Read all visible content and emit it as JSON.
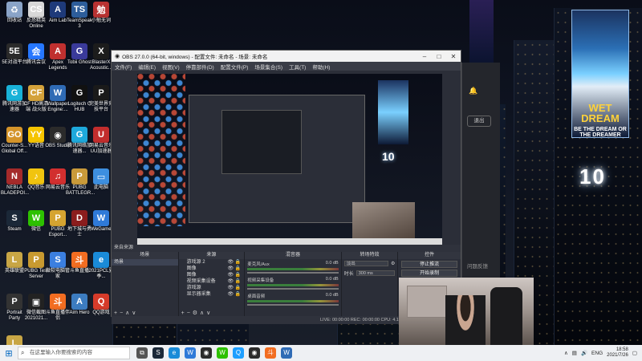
{
  "desktop_icons": [
    {
      "label": "回收站",
      "icon": "recycle-bin-icon",
      "color": "#8aa4c8",
      "glyph": "♻"
    },
    {
      "label": "反恐精英 Online",
      "icon": "cs-online-icon",
      "color": "#d8d8d8",
      "glyph": "CS"
    },
    {
      "label": "Aim Lab",
      "icon": "aimlab-icon",
      "color": "#1e3a7a",
      "glyph": "A"
    },
    {
      "label": "TeamSpeak 3",
      "icon": "teamspeak-icon",
      "color": "#2d5d9a",
      "glyph": "TS"
    },
    {
      "label": "小勉无词",
      "icon": "app-icon",
      "color": "#b83232",
      "glyph": "勉"
    },
    {
      "label": "5E对战平台",
      "icon": "5e-icon",
      "color": "#2a2a2a",
      "glyph": "5E"
    },
    {
      "label": "腾讯会议",
      "icon": "tencent-meeting-icon",
      "color": "#2677ff",
      "glyph": "会"
    },
    {
      "label": "Apex Legends",
      "icon": "apex-icon",
      "color": "#c0302f",
      "glyph": "A"
    },
    {
      "label": "Tobii Ghost",
      "icon": "tobii-icon",
      "color": "#3a3a9a",
      "glyph": "G"
    },
    {
      "label": "BlasterX Acoustic...",
      "icon": "blasterx-icon",
      "color": "#1c1c1c",
      "glyph": "X"
    },
    {
      "label": "腾讯网游加速器",
      "icon": "accelerator-icon",
      "color": "#19b2d8",
      "glyph": "G"
    },
    {
      "label": "CF HD高清端 战火版",
      "icon": "cf-icon",
      "color": "#d4a23a",
      "glyph": "CF"
    },
    {
      "label": "Wallpaper Engine:...",
      "icon": "wallpaper-engine-icon",
      "color": "#2f6bb5",
      "glyph": "W"
    },
    {
      "label": "Logitech G HUB",
      "icon": "logitech-icon",
      "color": "#111111",
      "glyph": "G"
    },
    {
      "label": "完美世界竞技平台",
      "icon": "perfect-world-icon",
      "color": "#1a1a1a",
      "glyph": "P"
    },
    {
      "label": "Counter-S... Global Off...",
      "icon": "csgo-icon",
      "color": "#d4942a",
      "glyph": "GO"
    },
    {
      "label": "YY语音",
      "icon": "yy-icon",
      "color": "#f5c400",
      "glyph": "YY"
    },
    {
      "label": "OBS Studio",
      "icon": "obs-icon",
      "color": "#2b2b2b",
      "glyph": "◉"
    },
    {
      "label": "腾讯网络加速器...",
      "icon": "accelerator-icon",
      "color": "#1ea9dc",
      "glyph": "G"
    },
    {
      "label": "网易云音乐 UU加速器",
      "icon": "uu-icon",
      "color": "#c22d2d",
      "glyph": "U"
    },
    {
      "label": "NEBLA BLADEPOI...",
      "icon": "game-icon",
      "color": "#a52a2a",
      "glyph": "N"
    },
    {
      "label": "QQ音乐",
      "icon": "qq-music-icon",
      "color": "#f1c40f",
      "glyph": "♪"
    },
    {
      "label": "网易云音乐",
      "icon": "netease-music-icon",
      "color": "#d22f2f",
      "glyph": "♫"
    },
    {
      "label": "PUBG BATTLEGR...",
      "icon": "pubg-icon",
      "color": "#c99a3a",
      "glyph": "P"
    },
    {
      "label": "此电脑",
      "icon": "this-pc-icon",
      "color": "#3d8fe0",
      "glyph": "▭"
    },
    {
      "label": "Steam",
      "icon": "steam-icon",
      "color": "#1b2838",
      "glyph": "S"
    },
    {
      "label": "微信",
      "icon": "wechat-icon",
      "color": "#2dc100",
      "glyph": "W"
    },
    {
      "label": "PUBG Esport...",
      "icon": "pubg-esport-icon",
      "color": "#d5a431",
      "glyph": "P"
    },
    {
      "label": "地下城与勇士",
      "icon": "dnf-icon",
      "color": "#8b1d1d",
      "glyph": "D"
    },
    {
      "label": "WeGame",
      "icon": "wegame-icon",
      "color": "#2f7ad8",
      "glyph": "W"
    },
    {
      "label": "英雄联盟",
      "icon": "lol-icon",
      "color": "#c8a645",
      "glyph": "L"
    },
    {
      "label": "PUBG Test Server",
      "icon": "pubg-test-icon",
      "color": "#c89a30",
      "glyph": "P"
    },
    {
      "label": "微软电脑管家",
      "icon": "pc-manager-icon",
      "color": "#3b7fe0",
      "glyph": "S"
    },
    {
      "label": "斗鱼直播",
      "icon": "douyu-icon",
      "color": "#f26d21",
      "glyph": "斗"
    },
    {
      "label": "2021PCL夏季...",
      "icon": "edge-icon",
      "color": "#1a8bd8",
      "glyph": "e"
    },
    {
      "label": "Portrait Party",
      "icon": "game-icon",
      "color": "#333333",
      "glyph": "P"
    },
    {
      "label": "微信截图 2021021...",
      "icon": "image-icon",
      "color": "#222222",
      "glyph": "▣"
    },
    {
      "label": "斗鱼直播伴侣",
      "icon": "douyu-icon",
      "color": "#f26d21",
      "glyph": "斗"
    },
    {
      "label": "Aim Hero",
      "icon": "aimhero-icon",
      "color": "#3c7cc0",
      "glyph": "A"
    },
    {
      "label": "QQ游戏",
      "icon": "qq-game-icon",
      "color": "#d63b2a",
      "glyph": "Q"
    },
    {
      "label": "英雄联盟",
      "icon": "lol-icon",
      "color": "#c8a645",
      "glyph": "L"
    }
  ],
  "obs": {
    "title": "OBS 27.0.0 (64-bit, windows) - 配置文件: 未命名 - 场景: 未命名",
    "menu": [
      "文件(F)",
      "编辑(E)",
      "视图(V)",
      "停靠部件(D)",
      "配置文件(P)",
      "场景集合(S)",
      "工具(T)",
      "帮助(H)"
    ],
    "scene_bar_label": "来自来源",
    "docks": {
      "scenes": {
        "title": "场景",
        "items": [
          "场景"
        ]
      },
      "sources": {
        "title": "来源",
        "items": [
          "游戏源 2",
          "图像",
          "图像",
          "视频采集设备",
          "游戏源",
          "显示器采集"
        ]
      },
      "mixer": {
        "title": "混音器",
        "channels": [
          {
            "name": "麦克风/Aux",
            "db": "0.0 dB"
          },
          {
            "name": "视频采集设备",
            "db": "0.0 dB"
          },
          {
            "name": "桌面音频",
            "db": "0.0 dB"
          }
        ]
      },
      "transitions": {
        "title": "转场特效",
        "type": "淡出",
        "duration_label": "时长",
        "duration": "300 ms"
      },
      "controls": {
        "title": "控件",
        "buttons": [
          "停止推流",
          "开始录制"
        ]
      }
    },
    "status": "LIVE: 00:00:00   REC: 00:00:00   CPU: 4.1%, 60.00 fps"
  },
  "side_panel": {
    "button": "退出",
    "bottom_text": "问题反馈"
  },
  "wallpaper": {
    "poster_line1": "WET DREAM",
    "poster_line2": "BE THE DREAM OR THE DREAMER",
    "neon_number": "10"
  },
  "taskbar": {
    "search_placeholder": "在这里输入你要搜索的内容",
    "apps": [
      {
        "icon": "task-view-icon",
        "color": "#555555",
        "glyph": "⧉"
      },
      {
        "icon": "steam-icon",
        "color": "#1b2838",
        "glyph": "S"
      },
      {
        "icon": "edge-icon",
        "color": "#1a8bd8",
        "glyph": "e"
      },
      {
        "icon": "wegame-icon",
        "color": "#2f7ad8",
        "glyph": "W"
      },
      {
        "icon": "obs-icon",
        "color": "#2b2b2b",
        "glyph": "◉"
      },
      {
        "icon": "wechat-icon",
        "color": "#2dc100",
        "glyph": "W"
      },
      {
        "icon": "qq-icon",
        "color": "#1e9fff",
        "glyph": "Q"
      },
      {
        "icon": "obs-icon",
        "color": "#2b2b2b",
        "glyph": "◉"
      },
      {
        "icon": "douyu-icon",
        "color": "#f26d21",
        "glyph": "斗"
      },
      {
        "icon": "wallpaper-engine-icon",
        "color": "#2f6bb5",
        "glyph": "W"
      }
    ],
    "lang": "ENG",
    "time": "18:58",
    "date": "2021/7/26"
  }
}
